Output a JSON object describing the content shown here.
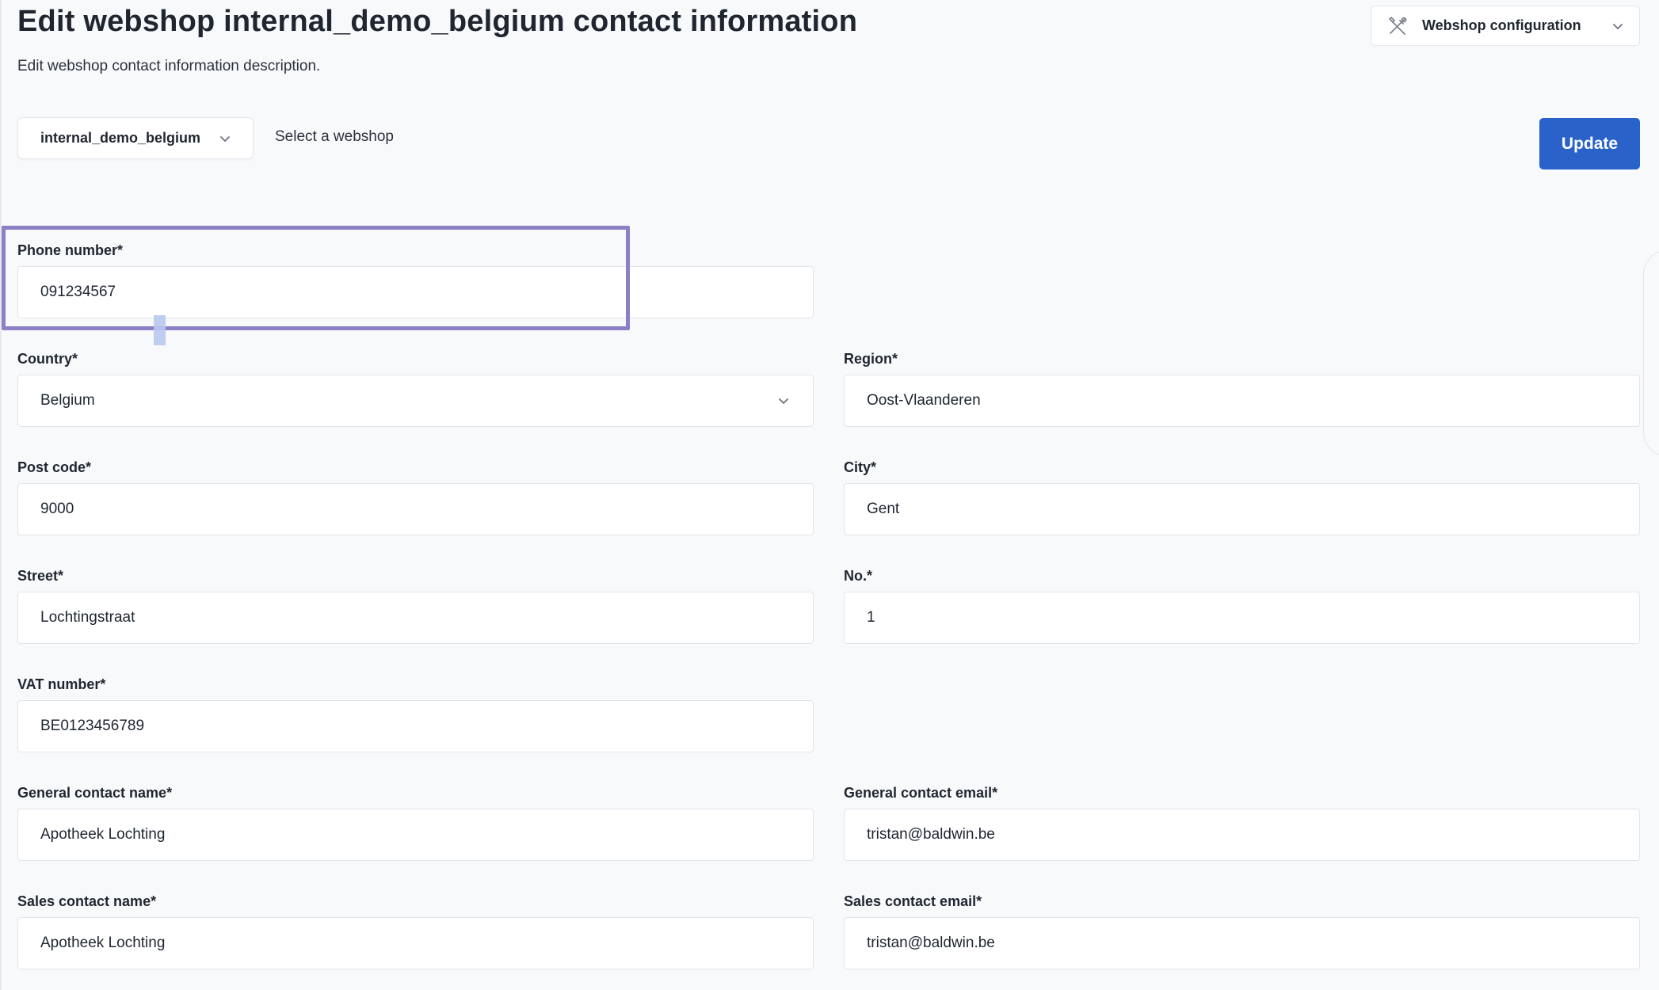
{
  "header": {
    "title": "Edit webshop internal_demo_belgium contact information",
    "description": "Edit webshop contact information description.",
    "config_menu": {
      "label": "Webshop configuration",
      "icon": "tools-icon"
    }
  },
  "webshop_selector": {
    "value": "internal_demo_belgium",
    "hint": "Select a webshop"
  },
  "actions": {
    "update_label": "Update"
  },
  "form": {
    "phone": {
      "label": "Phone number*",
      "value": "091234567"
    },
    "country": {
      "label": "Country*",
      "value": "Belgium"
    },
    "region": {
      "label": "Region*",
      "value": "Oost-Vlaanderen"
    },
    "post_code": {
      "label": "Post code*",
      "value": "9000"
    },
    "city": {
      "label": "City*",
      "value": "Gent"
    },
    "street": {
      "label": "Street*",
      "value": "Lochtingstraat"
    },
    "number": {
      "label": "No.*",
      "value": "1"
    },
    "vat": {
      "label": "VAT number*",
      "value": "BE0123456789"
    },
    "general_contact_name": {
      "label": "General contact name*",
      "value": "Apotheek Lochting"
    },
    "general_contact_email": {
      "label": "General contact email*",
      "value": "tristan@baldwin.be"
    },
    "sales_contact_name": {
      "label": "Sales contact name*",
      "value": "Apotheek Lochting"
    },
    "sales_contact_email": {
      "label": "Sales contact email*",
      "value": "tristan@baldwin.be"
    }
  },
  "colors": {
    "accent": "#2a62c9",
    "highlight": "#8c7fc4",
    "background": "#f8f9fb"
  }
}
